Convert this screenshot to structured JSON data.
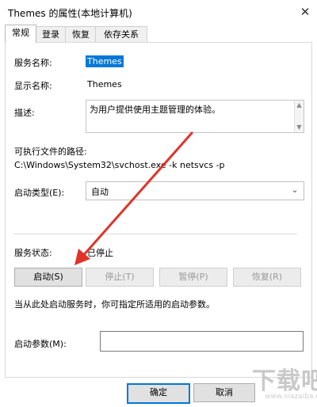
{
  "window": {
    "title": "Themes 的属性(本地计算机)",
    "close_glyph": "✕"
  },
  "tabs": [
    "常规",
    "登录",
    "恢复",
    "依存关系"
  ],
  "general": {
    "service_name_label": "服务名称:",
    "service_name_value": "Themes",
    "display_name_label": "显示名称:",
    "display_name_value": "Themes",
    "description_label": "描述:",
    "description_value": "为用户提供使用主题管理的体验。",
    "path_label": "可执行文件的路径:",
    "path_value": "C:\\Windows\\System32\\svchost.exe -k netsvcs -p",
    "startup_type_label": "启动类型(E):",
    "startup_type_value": "自动",
    "status_label": "服务状态:",
    "status_value": "已停止",
    "buttons": {
      "start": "启动(S)",
      "stop": "停止(T)",
      "pause": "暂停(P)",
      "resume": "恢复(R)"
    },
    "hint": "当从此处启动服务时，你可指定所适用的启动参数。",
    "start_params_label": "启动参数(M):",
    "start_params_value": ""
  },
  "footer": {
    "ok": "确定",
    "cancel": "取消"
  },
  "watermark": {
    "text": "下载吧",
    "url": "www.xiazaiba.com"
  },
  "colors": {
    "accent": "#0078d7",
    "arrow": "#e0342b"
  },
  "icons": {
    "scroll_up": "▲",
    "scroll_down": "▼",
    "combo_arrow": "⌄"
  }
}
